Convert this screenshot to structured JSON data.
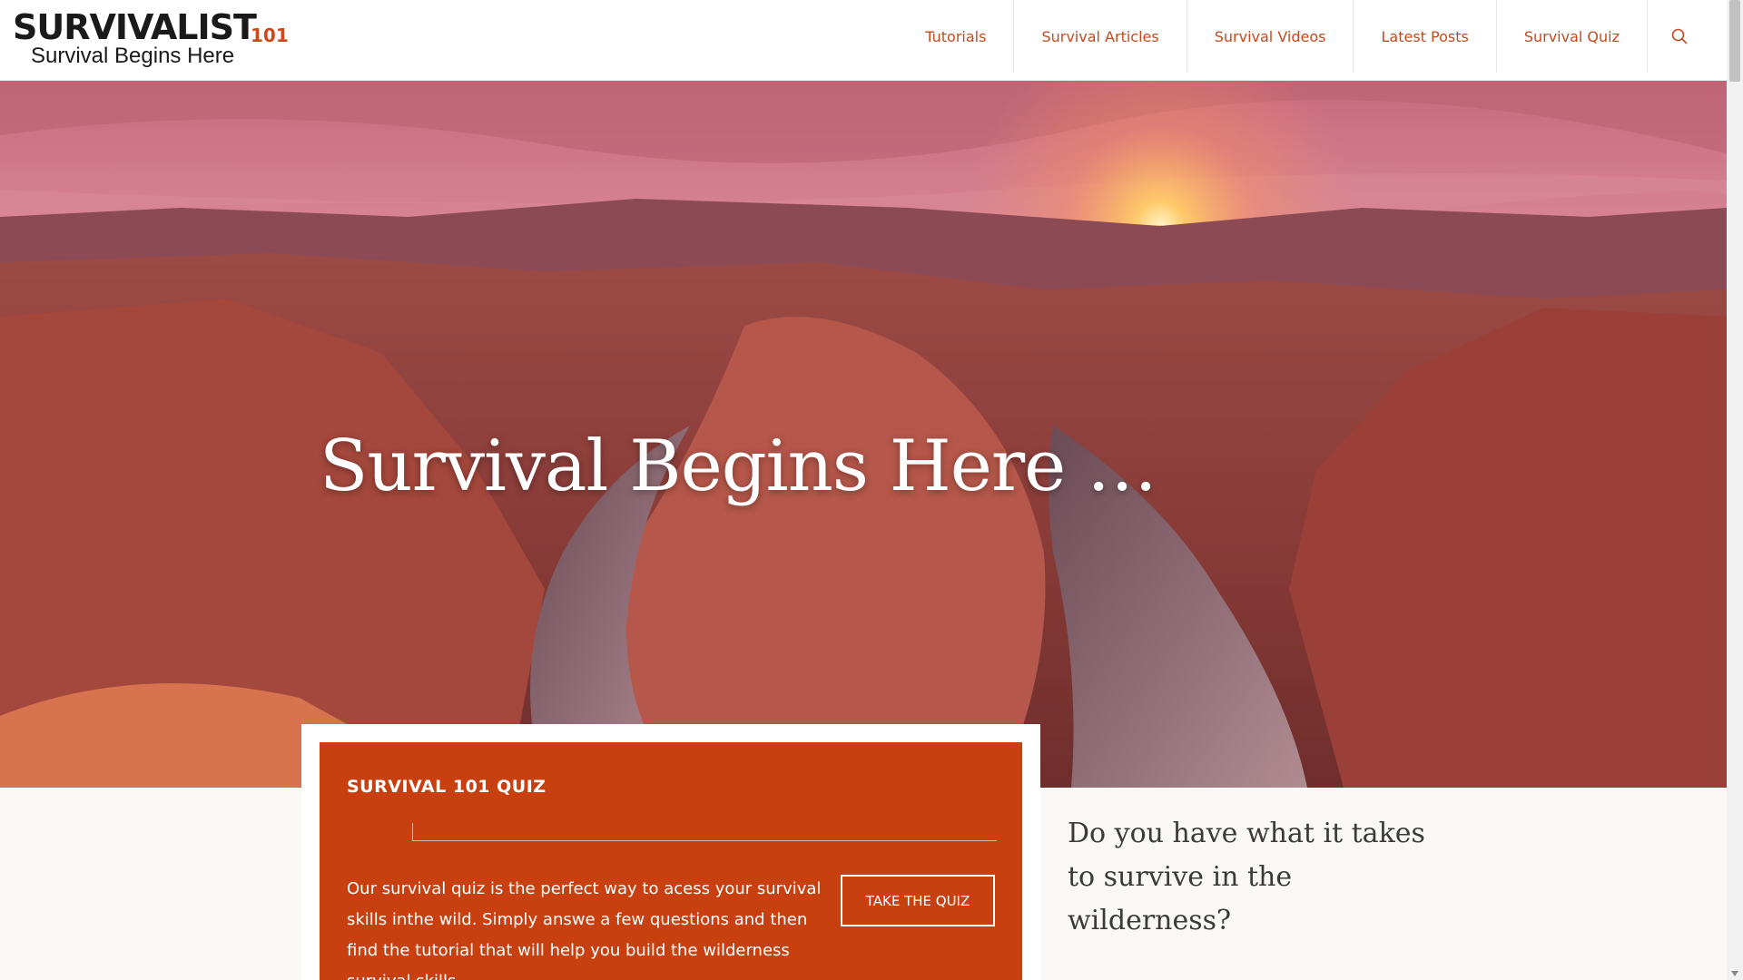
{
  "brand": {
    "logo_main": "SURVIVALIST",
    "logo_number": "101",
    "logo_tagline": "Survival Begins Here"
  },
  "nav": {
    "items": [
      {
        "label": "Tutorials"
      },
      {
        "label": "Survival Articles"
      },
      {
        "label": "Survival Videos"
      },
      {
        "label": "Latest Posts"
      },
      {
        "label": "Survival Quiz"
      }
    ],
    "search_icon": "search-icon"
  },
  "hero": {
    "title": "Survival Begins Here …"
  },
  "quiz_card": {
    "title": "SURVIVAL 101 QUIZ",
    "text": "Our survival quiz is the perfect way to acess your survival skills inthe wild. Simply answe a few questions and then find the tutorial that will help you build the wilderness survival skills.",
    "button_label": "TAKE THE QUIZ"
  },
  "side_question": "Do you have what it takes to survive in the wilderness?",
  "colors": {
    "accent": "#c8400f",
    "nav_text": "#c44a1e",
    "background": "#faf8f6"
  }
}
